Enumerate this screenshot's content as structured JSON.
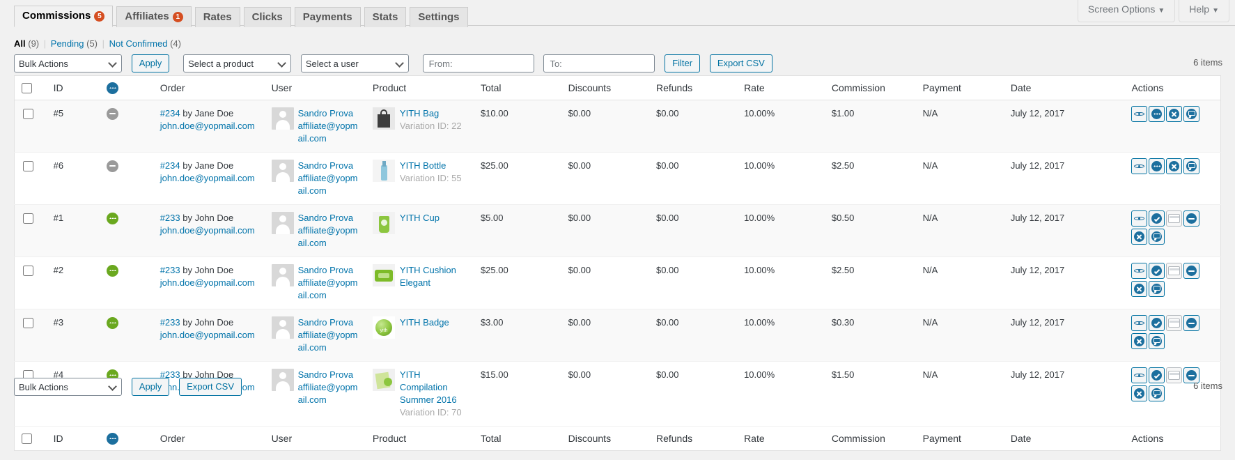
{
  "screen_meta": {
    "screen_options_label": "Screen Options",
    "help_label": "Help",
    "caret": "▼"
  },
  "tabs": [
    {
      "label": "Commissions",
      "badge": "5",
      "active": true
    },
    {
      "label": "Affiliates",
      "badge": "1",
      "active": false
    },
    {
      "label": "Rates",
      "badge": "",
      "active": false
    },
    {
      "label": "Clicks",
      "badge": "",
      "active": false
    },
    {
      "label": "Payments",
      "badge": "",
      "active": false
    },
    {
      "label": "Stats",
      "badge": "",
      "active": false
    },
    {
      "label": "Settings",
      "badge": "",
      "active": false
    }
  ],
  "status_links": [
    {
      "label": "All",
      "count": "(9)",
      "current": true
    },
    {
      "label": "Pending",
      "count": "(5)",
      "current": false
    },
    {
      "label": "Not Confirmed",
      "count": "(4)",
      "current": false
    }
  ],
  "toolbar": {
    "bulk_actions_value": "Bulk Actions",
    "apply_label": "Apply",
    "product_select_value": "Select a product",
    "user_select_value": "Select a user",
    "from_placeholder": "From:",
    "to_placeholder": "To:",
    "from_value": "",
    "to_value": "",
    "filter_label": "Filter",
    "export_label": "Export CSV",
    "items_count": "6 items"
  },
  "toolbar_bottom": {
    "bulk_actions_value": "Bulk Actions",
    "apply_label": "Apply",
    "export_label": "Export CSV",
    "items_count": "6 items"
  },
  "columns": {
    "id": "ID",
    "status": "",
    "order": "Order",
    "user": "User",
    "product": "Product",
    "total": "Total",
    "discounts": "Discounts",
    "refunds": "Refunds",
    "rate": "Rate",
    "commission": "Commission",
    "payment": "Payment",
    "date": "Date",
    "actions": "Actions"
  },
  "rows": [
    {
      "id": "#5",
      "status": "gray",
      "order_number": "#234",
      "order_by": "by Jane Doe",
      "order_email": "john.doe@yopmail.com",
      "user_name": "Sandro Prova",
      "user_email": "affiliate@yopmail.com",
      "product_name": "YITH Bag",
      "product_thumb": "thumb-bag",
      "variation": "Variation ID: 22",
      "total": "$10.00",
      "discounts": "$0.00",
      "refunds": "$0.00",
      "rate": "10.00%",
      "commission": "$1.00",
      "payment": "N/A",
      "date": "July 12, 2017",
      "actions": [
        "eye",
        "dots",
        "x",
        "note"
      ]
    },
    {
      "id": "#6",
      "status": "gray",
      "order_number": "#234",
      "order_by": "by Jane Doe",
      "order_email": "john.doe@yopmail.com",
      "user_name": "Sandro Prova",
      "user_email": "affiliate@yopmail.com",
      "product_name": "YITH Bottle",
      "product_thumb": "thumb-bottle",
      "variation": "Variation ID: 55",
      "total": "$25.00",
      "discounts": "$0.00",
      "refunds": "$0.00",
      "rate": "10.00%",
      "commission": "$2.50",
      "payment": "N/A",
      "date": "July 12, 2017",
      "actions": [
        "eye",
        "dots",
        "x",
        "note"
      ]
    },
    {
      "id": "#1",
      "status": "green",
      "order_number": "#233",
      "order_by": "by John Doe",
      "order_email": "john.doe@yopmail.com",
      "user_name": "Sandro Prova",
      "user_email": "affiliate@yopmail.com",
      "product_name": "YITH Cup",
      "product_thumb": "thumb-cup",
      "variation": "",
      "total": "$5.00",
      "discounts": "$0.00",
      "refunds": "$0.00",
      "rate": "10.00%",
      "commission": "$0.50",
      "payment": "N/A",
      "date": "July 12, 2017",
      "actions": [
        "eye",
        "check",
        "card",
        "minus",
        "x",
        "note"
      ]
    },
    {
      "id": "#2",
      "status": "green",
      "order_number": "#233",
      "order_by": "by John Doe",
      "order_email": "john.doe@yopmail.com",
      "user_name": "Sandro Prova",
      "user_email": "affiliate@yopmail.com",
      "product_name": "YITH Cushion Elegant",
      "product_thumb": "thumb-cushion",
      "variation": "",
      "total": "$25.00",
      "discounts": "$0.00",
      "refunds": "$0.00",
      "rate": "10.00%",
      "commission": "$2.50",
      "payment": "N/A",
      "date": "July 12, 2017",
      "actions": [
        "eye",
        "check",
        "card",
        "minus",
        "x",
        "note"
      ]
    },
    {
      "id": "#3",
      "status": "green",
      "order_number": "#233",
      "order_by": "by John Doe",
      "order_email": "john.doe@yopmail.com",
      "user_name": "Sandro Prova",
      "user_email": "affiliate@yopmail.com",
      "product_name": "YITH Badge",
      "product_thumb": "thumb-badge",
      "variation": "",
      "total": "$3.00",
      "discounts": "$0.00",
      "refunds": "$0.00",
      "rate": "10.00%",
      "commission": "$0.30",
      "payment": "N/A",
      "date": "July 12, 2017",
      "actions": [
        "eye",
        "check",
        "card",
        "minus",
        "x",
        "note"
      ]
    },
    {
      "id": "#4",
      "status": "green",
      "order_number": "#233",
      "order_by": "by John Doe",
      "order_email": "john.doe@yopmail.com",
      "user_name": "Sandro Prova",
      "user_email": "affiliate@yopmail.com",
      "product_name": "YITH Compilation Summer 2016",
      "product_thumb": "thumb-compilation",
      "variation": "Variation ID: 70",
      "total": "$15.00",
      "discounts": "$0.00",
      "refunds": "$0.00",
      "rate": "10.00%",
      "commission": "$1.50",
      "payment": "N/A",
      "date": "July 12, 2017",
      "actions": [
        "eye",
        "check",
        "card",
        "minus",
        "x",
        "note"
      ]
    }
  ],
  "colors": {
    "link": "#0073aa",
    "badge": "#d54e21",
    "status_green": "#6aa81f",
    "status_gray": "#9a9a9a",
    "action_blue": "#1c6f9e"
  }
}
